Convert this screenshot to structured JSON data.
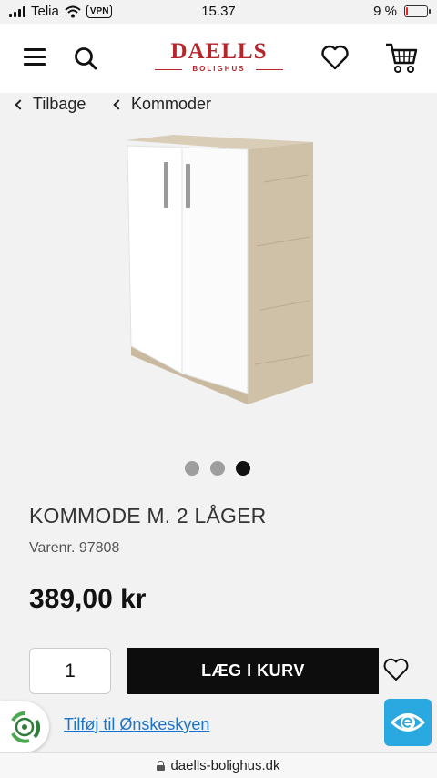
{
  "status_bar": {
    "carrier": "Telia",
    "vpn": "VPN",
    "time": "15.37",
    "battery_percent": "9 %",
    "battery_level": 0.09
  },
  "header": {
    "logo_main": "DAELLS",
    "logo_sub": "BOLIGHUS",
    "menu_icon": "hamburger-menu-icon",
    "search_icon": "magnifier-search-icon",
    "favorites_icon": "heart-outline-icon",
    "cart_icon": "shopping-cart-icon",
    "brand_color": "#b5262b"
  },
  "breadcrumbs": {
    "back_label": "Tilbage",
    "category_label": "Kommoder"
  },
  "gallery": {
    "image_count": 3,
    "active_index": 2
  },
  "product": {
    "title": "KOMMODE M. 2 LÅGER",
    "sku": "Varenr. 97808",
    "price": "389,00 kr"
  },
  "purchase": {
    "quantity": "1",
    "add_to_cart_label": "LÆG I KURV",
    "wishlist_icon": "heart-outline-icon"
  },
  "wishlist": {
    "link_label": "Tilføj til Ønskeskyen",
    "badge_icon": "wishcloud-badge-icon"
  },
  "trust_badge": {
    "icon": "e-maerket-icon",
    "color": "#29a9e0"
  },
  "browser": {
    "url": "daells-bolighus.dk"
  }
}
